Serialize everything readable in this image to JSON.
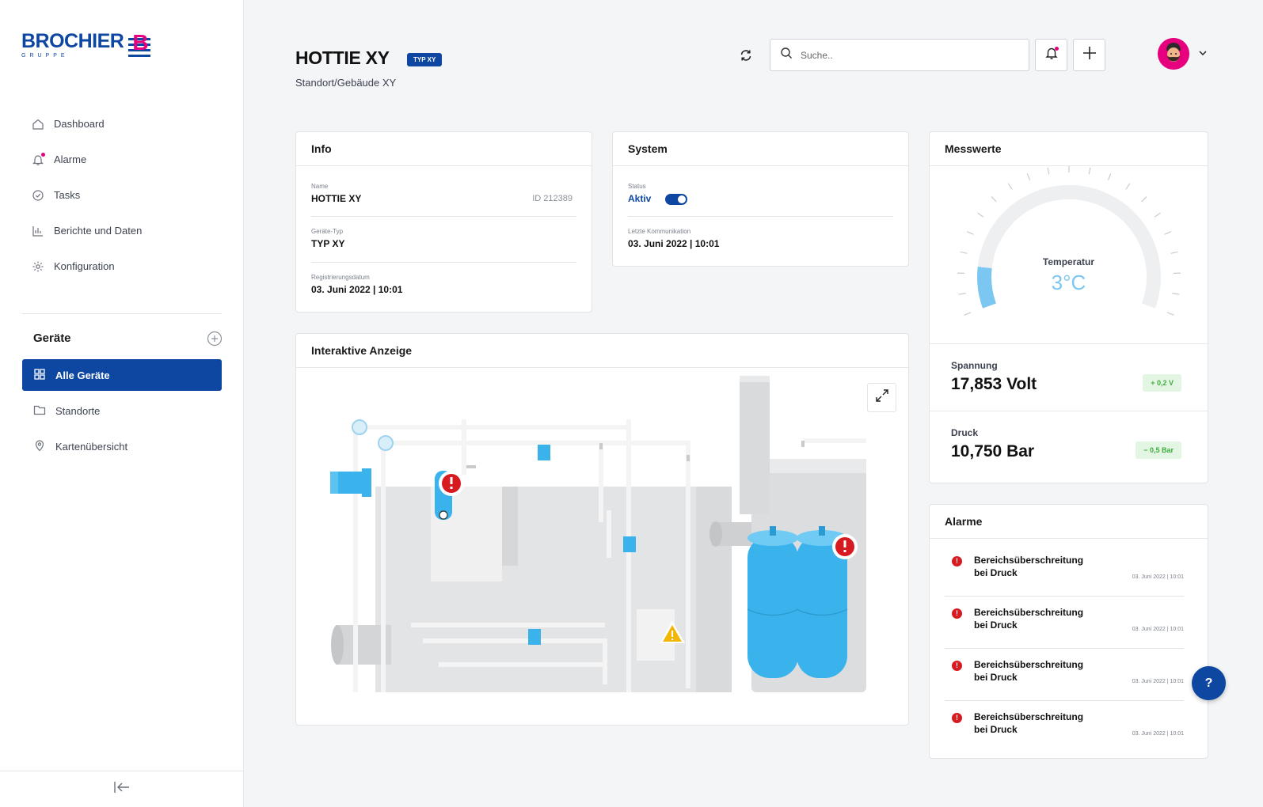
{
  "brand": {
    "name": "BROCHIER",
    "sub": "GRUPPE",
    "mark_letter": "B"
  },
  "nav": {
    "items": [
      {
        "label": "Dashboard",
        "icon": "home-icon"
      },
      {
        "label": "Alarme",
        "icon": "bell-icon"
      },
      {
        "label": "Tasks",
        "icon": "check-circle-icon"
      },
      {
        "label": "Berichte und Daten",
        "icon": "bar-chart-icon"
      },
      {
        "label": "Konfiguration",
        "icon": "gear-icon"
      }
    ]
  },
  "devices": {
    "title": "Geräte",
    "items": [
      {
        "label": "Alle Geräte",
        "icon": "grid-icon",
        "active": true
      },
      {
        "label": "Standorte",
        "icon": "folder-icon"
      },
      {
        "label": "Kartenübersicht",
        "icon": "map-pin-icon"
      }
    ]
  },
  "header": {
    "title": "HOTTIE XY",
    "type_badge": "TYP XY",
    "subtitle": "Standort/Gebäude XY",
    "search_placeholder": "Suche.."
  },
  "info": {
    "title": "Info",
    "name_label": "Name",
    "name_value": "HOTTIE XY",
    "id": "ID 212389",
    "type_label": "Geräte-Typ",
    "type_value": "TYP XY",
    "reg_label": "Registrierungsdatum",
    "reg_value": "03. Juni 2022 | 10:01"
  },
  "system": {
    "title": "System",
    "status_label": "Status",
    "status_value": "Aktiv",
    "status_on": true,
    "comm_label": "Letzte Kommunikation",
    "comm_value": "03. Juni 2022 | 10:01"
  },
  "display": {
    "title": "Interaktive Anzeige"
  },
  "measures": {
    "title": "Messwerte",
    "gauge_label": "Temperatur",
    "gauge_value": "3°C",
    "gauge_fraction": 0.12,
    "voltage_label": "Spannung",
    "voltage_value": "17,853 Volt",
    "voltage_delta": "+ 0,2 V",
    "pressure_label": "Druck",
    "pressure_value": "10,750 Bar",
    "pressure_delta": "− 0,5 Bar"
  },
  "alarms": {
    "title": "Alarme",
    "items": [
      {
        "line1": "Bereichsüberschreitung",
        "line2": "bei Druck",
        "time": "03. Juni 2022 | 10:01"
      },
      {
        "line1": "Bereichsüberschreitung",
        "line2": "bei Druck",
        "time": "03. Juni 2022 | 10:01"
      },
      {
        "line1": "Bereichsüberschreitung",
        "line2": "bei Druck",
        "time": "03. Juni 2022 | 10:01"
      },
      {
        "line1": "Bereichsüberschreitung",
        "line2": "bei Druck",
        "time": "03. Juni 2022 | 10:01"
      }
    ]
  },
  "help": {
    "label": "?"
  },
  "colors": {
    "primary": "#0d47a1",
    "accent": "#e6007e",
    "alert": "#d71920",
    "gauge": "#7cc6f2",
    "success": "#3fae3f"
  }
}
